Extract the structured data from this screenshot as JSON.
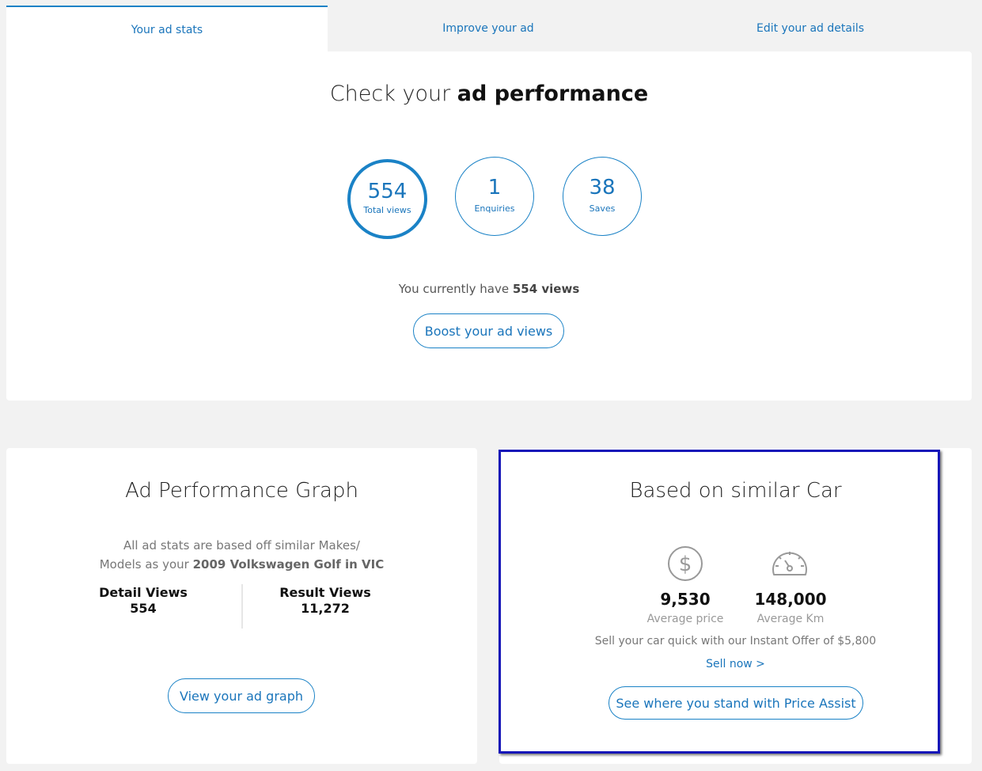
{
  "tabs": [
    {
      "label": "Your ad stats",
      "active": true
    },
    {
      "label": "Improve your ad",
      "active": false
    },
    {
      "label": "Edit your ad details",
      "active": false
    }
  ],
  "performance": {
    "title_prefix": "Check your ",
    "title_bold": "ad performance",
    "stats": [
      {
        "value": "554",
        "label": "Total views",
        "active": true
      },
      {
        "value": "1",
        "label": "Enquiries",
        "active": false
      },
      {
        "value": "38",
        "label": "Saves",
        "active": false
      }
    ],
    "views_text_prefix": "You currently have ",
    "views_text_bold": "554 views",
    "boost_button": "Boost your ad views"
  },
  "graph": {
    "title": "Ad Performance Graph",
    "note_line1": "All ad stats are based off similar Makes/",
    "note_line2_prefix": "Models as your ",
    "note_line2_bold": "2009 Volkswagen Golf in VIC",
    "detail_label": "Detail Views",
    "detail_value": "554",
    "result_label": "Result Views",
    "result_value": "11,272",
    "button": "View your ad graph"
  },
  "similar": {
    "title": "Based on similar Car",
    "price_icon": "dollar-icon",
    "km_icon": "gauge-icon",
    "price_value": "9,530",
    "price_label": "Average price",
    "km_value": "148,000",
    "km_label": "Average Km",
    "offer_text": "Sell your car quick with our Instant Offer of $5,800",
    "sell_link": "Sell now >",
    "button": "See where you stand with Price Assist"
  },
  "colors": {
    "accent": "#1a82c6",
    "highlight_border": "#1616b8",
    "background": "#f2f2f2"
  }
}
